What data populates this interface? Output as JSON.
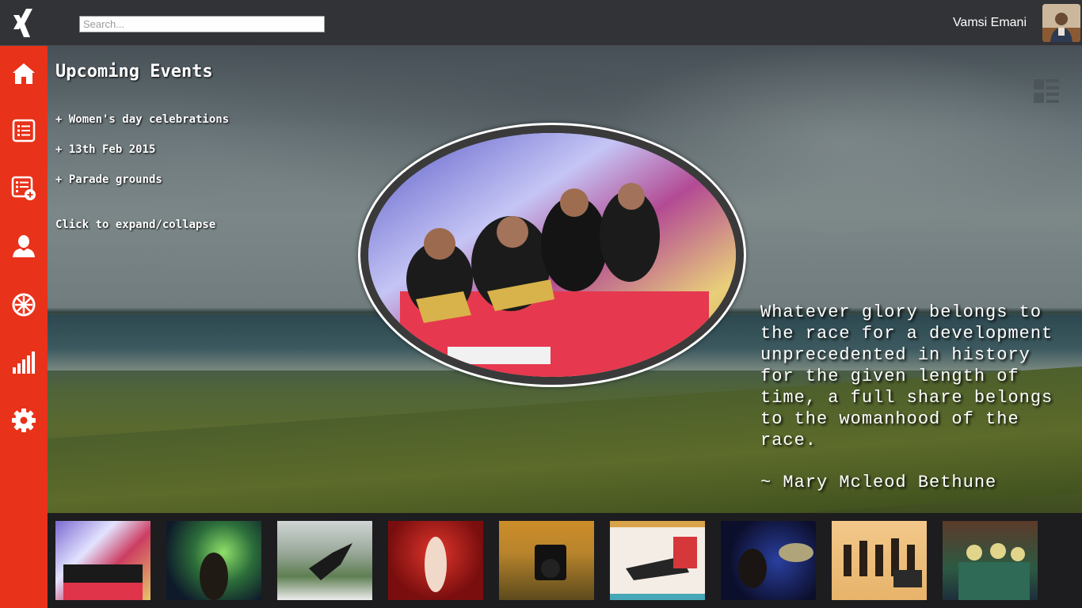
{
  "header": {
    "search_placeholder": "Search...",
    "user_name": "Vamsi Emani",
    "logo_icon": "xing-logo-icon"
  },
  "sidebar": {
    "items": [
      {
        "icon": "home-icon"
      },
      {
        "icon": "list-icon"
      },
      {
        "icon": "list-add-icon"
      },
      {
        "icon": "user-icon"
      },
      {
        "icon": "wheel-icon"
      },
      {
        "icon": "signal-bars-icon"
      },
      {
        "icon": "gear-icon"
      }
    ],
    "accent_color": "#e8321a"
  },
  "events": {
    "title": "Upcoming Events",
    "lines": [
      "+ Women's day celebrations",
      "+ 13th Feb 2015",
      "+ Parade grounds"
    ],
    "toggle_label": "Click to expand/collapse"
  },
  "quote": {
    "lines": [
      "Whatever glory belongs to",
      "the race for a development",
      "unprecedented in history",
      "for the given length of",
      "time, a full share belongs",
      "to the womanhood of the",
      "race."
    ],
    "author": "~ Mary Mcleod Bethune"
  },
  "thumbnails": [
    {
      "name": "dance-troupe-thumbnail"
    },
    {
      "name": "guitarist-stage-thumbnail"
    },
    {
      "name": "breakdancer-thumbnail"
    },
    {
      "name": "dancer-red-stage-thumbnail"
    },
    {
      "name": "camera-thumbnail"
    },
    {
      "name": "actor-on-floor-thumbnail"
    },
    {
      "name": "drummer-thumbnail"
    },
    {
      "name": "chess-poster-thumbnail"
    },
    {
      "name": "friends-group-thumbnail"
    }
  ]
}
